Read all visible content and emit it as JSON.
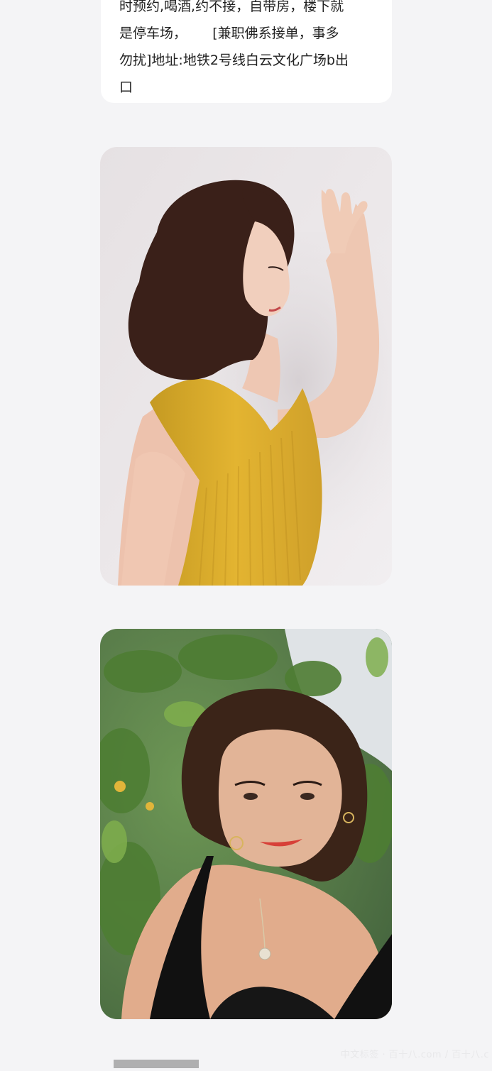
{
  "post": {
    "lines": [
      "时预约,喝酒,约不接，自带房，楼下就",
      "是停车场，      [兼职佛系接单，事多",
      "勿扰]地址:地铁2号线白云文化广场b出",
      "口"
    ]
  },
  "photos": [
    {
      "label": "photo"
    },
    {
      "label": "photo"
    }
  ],
  "watermark": {
    "text": "中文标签 · 百十八.com / 百十八.c"
  }
}
